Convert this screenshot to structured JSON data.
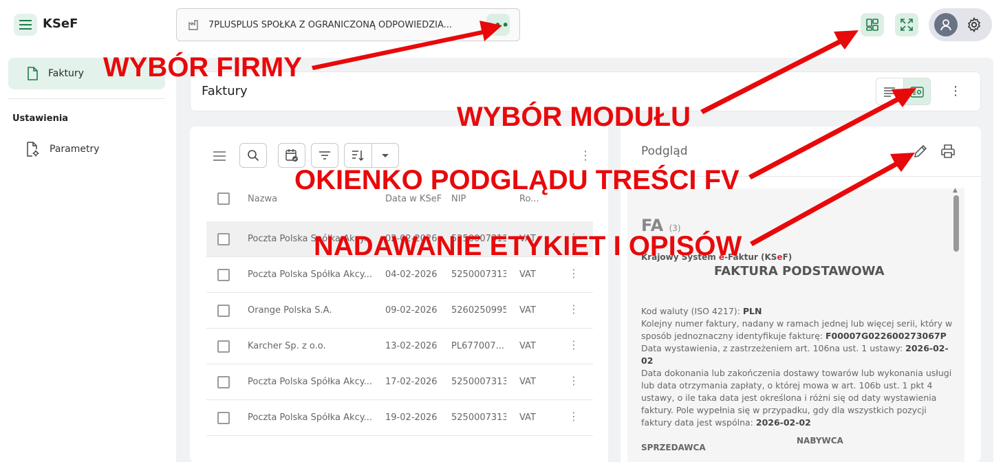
{
  "app": {
    "title": "KSeF"
  },
  "company": {
    "name": "7PLUSPLUS SPÓŁKA Z OGRANICZONĄ ODPOWIEDZIA...",
    "more": "•••"
  },
  "sidebar": {
    "active_item": "Faktury",
    "section": "Ustawienia",
    "items": [
      {
        "label": "Parametry"
      }
    ]
  },
  "header": {
    "title": "Faktury"
  },
  "table": {
    "columns": [
      "Nazwa",
      "Data w KSeF",
      "NIP",
      "Ro..."
    ],
    "rows": [
      {
        "name": "Poczta Polska Spółka Akcy...",
        "date": "02-02-2026",
        "nip": "5250007313",
        "type": "VAT"
      },
      {
        "name": "Poczta Polska Spółka Akcy...",
        "date": "04-02-2026",
        "nip": "5250007313",
        "type": "VAT"
      },
      {
        "name": "Orange Polska S.A.",
        "date": "09-02-2026",
        "nip": "5260250995",
        "type": "VAT"
      },
      {
        "name": "Karcher Sp. z o.o.",
        "date": "13-02-2026",
        "nip": "PL677007...",
        "type": "VAT"
      },
      {
        "name": "Poczta Polska Spółka Akcy...",
        "date": "17-02-2026",
        "nip": "5250007313",
        "type": "VAT"
      },
      {
        "name": "Poczta Polska Spółka Akcy...",
        "date": "19-02-2026",
        "nip": "5250007313",
        "type": "VAT"
      }
    ]
  },
  "preview": {
    "title": "Podgląd",
    "doc": {
      "fa": "FA",
      "fa_ver": "(3)",
      "ksef_pre": "Krajowy System ",
      "ksef_e": "e",
      "ksef_mid": "-Faktur (KS",
      "ksef_e2": "e",
      "ksef_post": "F)",
      "kind": "FAKTURA PODSTAWOWA",
      "currency_label": "Kod waluty (ISO 4217): ",
      "currency": "PLN",
      "number_label": "Kolejny numer faktury, nadany w ramach jednej lub więcej serii, który w sposób jednoznaczny identyfikuje fakturę: ",
      "number": "F00007G022600273067P",
      "issue_label": "Data wystawienia, z zastrzeżeniem art. 106na ust. 1 ustawy: ",
      "issue_date": "2026-02-02",
      "delivery_label": "Data dokonania lub zakończenia dostawy towarów lub wykonania usługi lub data otrzymania zapłaty, o której mowa w art. 106b ust. 1 pkt 4 ustawy, o ile taka data jest określona i różni się od daty wystawienia faktury. Pole wypełnia się w przypadku, gdy dla wszystkich pozycji faktury data jest wspólna: ",
      "delivery_date": "2026-02-02",
      "seller": "SPRZEDAWCA",
      "buyer": "NABYWCA"
    }
  },
  "annotations": {
    "firma": "WYBÓR FIRMY",
    "modul": "WYBÓR MODUŁU",
    "podglad": "OKIENKO PODGLĄDU TREŚCI FV",
    "etykiety": "NADAWANIE ETYKIET I OPISÓW",
    "color": "#e8090b"
  },
  "colors": {
    "accent": "#1e7a4c",
    "accent_bg": "#dcefe4"
  }
}
